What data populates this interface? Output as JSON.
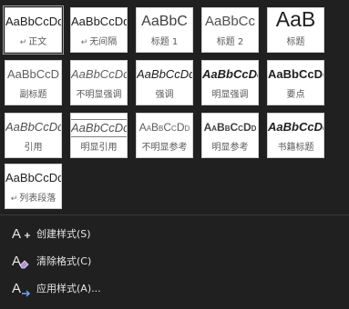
{
  "styles": [
    {
      "sample": "AaBbCcDd",
      "name": "正文",
      "para": "↵",
      "selected": true
    },
    {
      "sample": "AaBbCcDd",
      "name": "无间隔",
      "para": "↵"
    },
    {
      "sample": "AaBbC",
      "name": "标题 1"
    },
    {
      "sample": "AaBbCc",
      "name": "标题 2"
    },
    {
      "sample": "AaB",
      "name": "标题"
    },
    {
      "sample": "AaBbCcD",
      "name": "副标题"
    },
    {
      "sample": "AaBbCcDd",
      "name": "不明显强调"
    },
    {
      "sample": "AaBbCcDd",
      "name": "强调"
    },
    {
      "sample": "AaBbCcDd",
      "name": "明显强调"
    },
    {
      "sample": "AaBbCcDd",
      "name": "要点"
    },
    {
      "sample": "AaBbCcDd",
      "name": "引用"
    },
    {
      "sample": "AaBbCcDd",
      "name": "明显引用"
    },
    {
      "sample": "AaBbCcDd",
      "name": "不明显参考"
    },
    {
      "sample": "AaBbCcDd",
      "name": "明显参考"
    },
    {
      "sample": "AaBbCcDd",
      "name": "书籍标题"
    },
    {
      "sample": "AaBbCcDd",
      "name": "列表段落",
      "para": "↵"
    }
  ],
  "menu": {
    "create_style": {
      "label": "创建样式(S)",
      "icon": "create-style-icon"
    },
    "clear_formatting": {
      "label": "清除格式(C)",
      "icon": "clear-formatting-icon"
    },
    "apply_styles": {
      "label": "应用样式(A)...",
      "icon": "apply-styles-icon"
    }
  },
  "colors": {
    "background": "#202020",
    "tile": "#ffffff",
    "accent_purple": "#b48fd8",
    "accent_blue": "#6ea8ff"
  }
}
